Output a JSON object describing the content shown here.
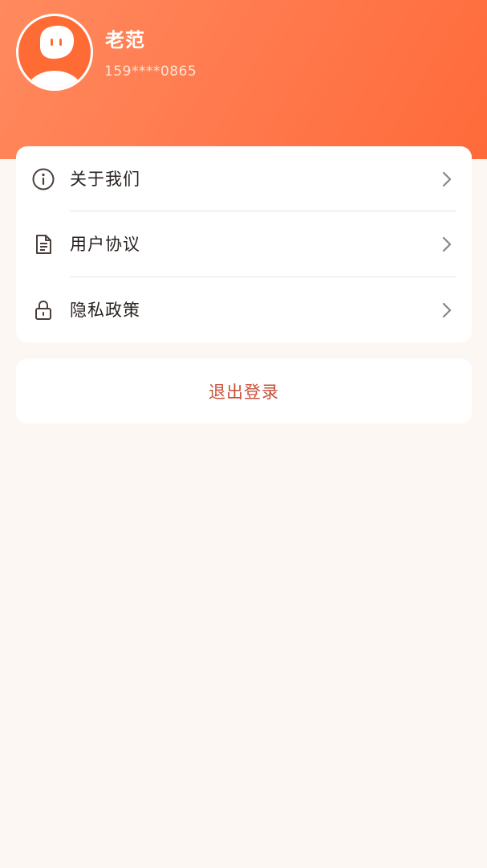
{
  "profile": {
    "name": "老范",
    "phone": "159****0865",
    "avatar_icon": "avatar-icon"
  },
  "menu": {
    "items": [
      {
        "label": "关于我们",
        "icon": "info-icon"
      },
      {
        "label": "用户协议",
        "icon": "document-icon"
      },
      {
        "label": "隐私政策",
        "icon": "lock-icon"
      }
    ],
    "chevron_icon": "chevron-right-icon"
  },
  "logout": {
    "label": "退出登录"
  },
  "colors": {
    "header_gradient_start": "#ff8a5e",
    "header_gradient_end": "#ff6a3a",
    "logout_text": "#c7503a",
    "page_background": "#fdf7f4"
  }
}
